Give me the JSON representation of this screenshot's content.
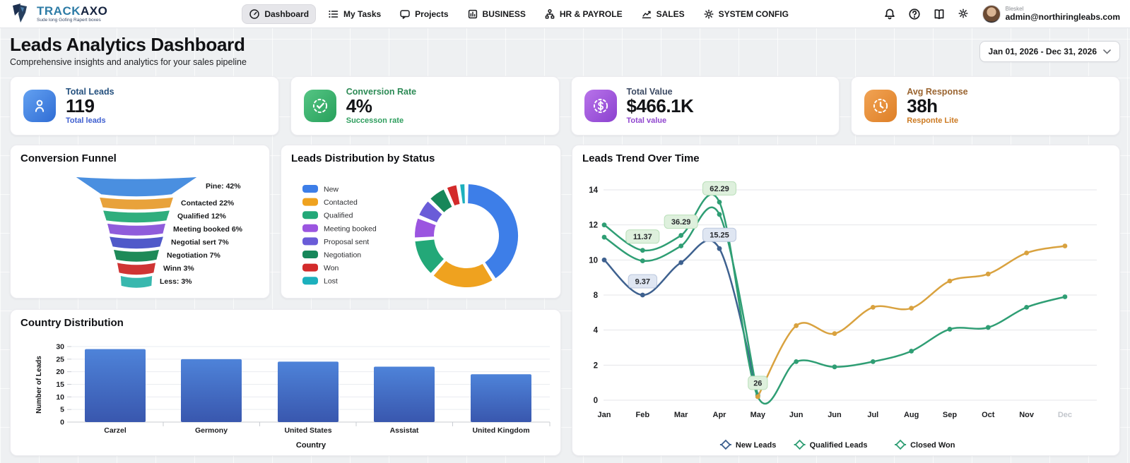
{
  "brand": {
    "track": "TRACK",
    "axo": "AXO",
    "tagline": "Sude long Gofing Rapert boxes"
  },
  "nav": {
    "items": [
      {
        "label": "Dashboard",
        "icon": "gauge-icon",
        "active": true
      },
      {
        "label": "My Tasks",
        "icon": "list-icon",
        "active": false
      },
      {
        "label": "Projects",
        "icon": "chat-icon",
        "active": false
      },
      {
        "label": "BUSINESS",
        "icon": "chart-board-icon",
        "active": false
      },
      {
        "label": "HR & PAYROLE",
        "icon": "org-icon",
        "active": false
      },
      {
        "label": "SALES",
        "icon": "trend-icon",
        "active": false
      },
      {
        "label": "SYSTEM CONFIG",
        "icon": "gear-icon",
        "active": false
      }
    ]
  },
  "header_icons": [
    {
      "name": "bell-icon"
    },
    {
      "name": "help-icon"
    },
    {
      "name": "book-icon"
    },
    {
      "name": "gear-icon"
    }
  ],
  "user": {
    "name": "Bleskel",
    "email": "admin@northiringleabs.com"
  },
  "page": {
    "title": "Leads Analytics Dashboard",
    "subtitle": "Comprehensive insights and analytics for your sales pipeline",
    "date_range": "Jan 01, 2026 - Dec 31, 2026"
  },
  "kpis": [
    {
      "label": "Total Leads",
      "value": "119",
      "sub": "Total leads",
      "icon": "person-icon",
      "label_color": "#24507e",
      "sub_color": "#3f5fd0",
      "grad": [
        "#63a1f1",
        "#2f6cd4"
      ]
    },
    {
      "label": "Conversion Rate",
      "value": "4%",
      "sub": "Successon rate",
      "icon": "check-icon",
      "label_color": "#2c8a55",
      "sub_color": "#2f9e5e",
      "grad": [
        "#55c584",
        "#27a05b"
      ]
    },
    {
      "label": "Total Value",
      "value": "$466.1K",
      "sub": "Total value",
      "icon": "dollar-icon",
      "label_color": "#3c4a63",
      "sub_color": "#9147cf",
      "grad": [
        "#b873ea",
        "#8b41cf"
      ]
    },
    {
      "label": "Avg Response",
      "value": "38h",
      "sub": "Responte Lite",
      "icon": "clock-icon",
      "label_color": "#9a6430",
      "sub_color": "#cc7a22",
      "grad": [
        "#f1a354",
        "#de7f26"
      ]
    }
  ],
  "chart_data": [
    {
      "type": "funnel",
      "title": "Conversion Funnel",
      "stages": [
        {
          "label": "Pine: 42%",
          "value": 42,
          "color": "#4a8fe0"
        },
        {
          "label": "Contacted 22%",
          "value": 22,
          "color": "#e8a23b"
        },
        {
          "label": "Qualified 12%",
          "value": 12,
          "color": "#2fae7d"
        },
        {
          "label": "Meeting booked 6%",
          "value": 6,
          "color": "#8f5cdb"
        },
        {
          "label": "Negotial sert 7%",
          "value": 7,
          "color": "#5059c9"
        },
        {
          "label": "Negotiation 7%",
          "value": 7,
          "color": "#1e8a58"
        },
        {
          "label": "Winn 3%",
          "value": 3,
          "color": "#cf3434"
        },
        {
          "label": "Less: 3%",
          "value": 3,
          "color": "#38b8ae"
        }
      ]
    },
    {
      "type": "pie",
      "title": "Leads Distribution by Status",
      "legend_position": "left",
      "slices": [
        {
          "label": "New",
          "value": 40,
          "color": "#3d7ee8"
        },
        {
          "label": "Contacted",
          "value": 20,
          "color": "#efa21f"
        },
        {
          "label": "Qualified",
          "value": 12,
          "color": "#23a878"
        },
        {
          "label": "Meeting booked",
          "value": 7,
          "color": "#9b55e0"
        },
        {
          "label": "Proposal sent",
          "value": 6,
          "color": "#6a5cd8"
        },
        {
          "label": "Negotiation",
          "value": 6,
          "color": "#17875a"
        },
        {
          "label": "Won",
          "value": 4,
          "color": "#d32b2b"
        },
        {
          "label": "Lost",
          "value": 2.5,
          "color": "#1cb0bd"
        }
      ]
    },
    {
      "type": "line",
      "title": "Leads Trend Over Time",
      "x": [
        "Jan",
        "Feb",
        "Mar",
        "Apr",
        "May",
        "Jun",
        "Jun",
        "Jul",
        "Aug",
        "Sep",
        "Oct",
        "Nov",
        "Dec"
      ],
      "y_ticks": [
        14,
        12,
        10,
        8,
        4,
        2,
        0
      ],
      "x_last_muted": true,
      "series": [
        {
          "name": "New Leads",
          "color": "#3e618f",
          "values": [
            10,
            8,
            9.85,
            10.65,
            0.3,
            null,
            null,
            null,
            null,
            null,
            null,
            null,
            null
          ],
          "labels": {
            "1": "9.37",
            "3": "15.25"
          },
          "label_bg": "#dfe6f2",
          "label_border": "#bcc8de"
        },
        {
          "name": "Closed Won",
          "color": "#2f9e74",
          "values": [
            11.3,
            9.95,
            10.8,
            12.6,
            0.25,
            null,
            null,
            null,
            null,
            null,
            null,
            null,
            null
          ],
          "labels": {},
          "label_bg": "#def0dd",
          "label_border": "#badfba"
        },
        {
          "name": "Qualified Leads",
          "color": "#2f9e74",
          "values": [
            12,
            10.55,
            11.4,
            13.3,
            0.2,
            2.2,
            1.9,
            2.2,
            2.8,
            4.1,
            4.3,
            6.6,
            7.8
          ],
          "labels": {
            "1": "11.37",
            "2": "36.29",
            "3": "62.29",
            "4": "26"
          },
          "label_bg": "#def0dd",
          "label_border": "#badfba"
        },
        {
          "name": "",
          "color": "#d9a23f",
          "values": [
            null,
            null,
            null,
            null,
            0.2,
            4.5,
            3.8,
            6.6,
            6.5,
            8.8,
            9.2,
            10.4,
            10.8
          ],
          "labels": {},
          "label_bg": "#f4ead2",
          "label_border": "#e2cfa0"
        }
      ],
      "legend": [
        {
          "label": "New Leads",
          "color": "#3e618f"
        },
        {
          "label": "Qualified Leads",
          "color": "#2f9e74"
        },
        {
          "label": "Closed Won",
          "color": "#2f9e74"
        }
      ]
    },
    {
      "type": "bar",
      "title": "Country Distribution",
      "categories": [
        "Carzel",
        "Germony",
        "United States",
        "Assistat",
        "United Kingdom"
      ],
      "values": [
        29,
        25,
        24,
        22,
        19
      ],
      "xlabel": "Country",
      "ylabel": "Number of Leads",
      "y_ticks": [
        0,
        5,
        10,
        15,
        20,
        25,
        30
      ],
      "ylim": [
        0,
        30
      ],
      "bar_color_top": "#4e83d9",
      "bar_color_bottom": "#3957ae"
    }
  ]
}
